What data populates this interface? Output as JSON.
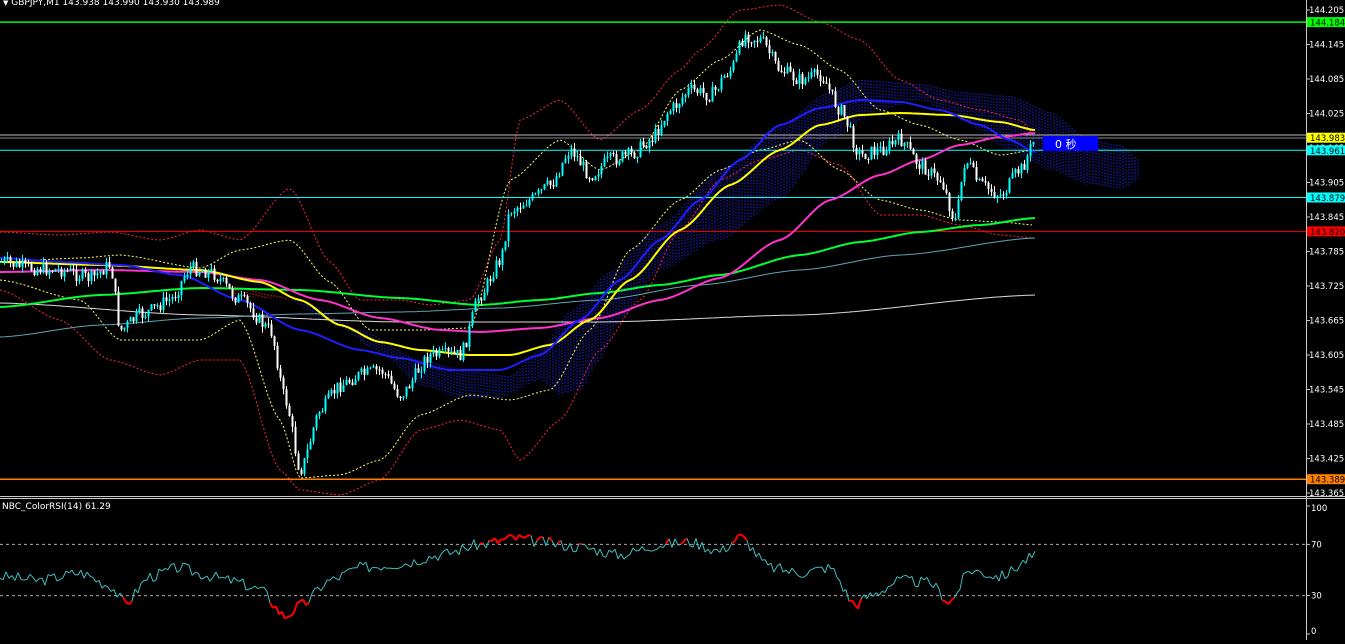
{
  "header": {
    "symbol_text": "GBPJPY,M1  143.938 143.990 143.930 143.989",
    "symbol_arrow": "▼"
  },
  "price_axis": {
    "ticks": [
      "144.205",
      "144.145",
      "144.085",
      "144.025",
      "143.965",
      "143.905",
      "143.845",
      "143.785",
      "143.725",
      "143.665",
      "143.605",
      "143.545",
      "143.485",
      "143.425",
      "143.365"
    ],
    "tags": [
      {
        "label": "144.184",
        "color": "#00ff00",
        "text_color": "#000000"
      },
      {
        "label": "143.983",
        "color": "#ffff00",
        "text_color": "#000000"
      },
      {
        "label": "143.961",
        "color": "#00ffff",
        "text_color": "#000000"
      },
      {
        "label": "143.879",
        "color": "#00ffff",
        "text_color": "#000000"
      },
      {
        "label": "143.820",
        "color": "#ff0000",
        "text_color": "#000000"
      },
      {
        "label": "143.389",
        "color": "#ff8000",
        "text_color": "#000000"
      }
    ]
  },
  "countdown": {
    "text": "0 秒",
    "color": "#0000ff"
  },
  "rsi_panel": {
    "title": "NBC_ColorRSI(14) 61.29",
    "ticks": [
      "100",
      "70",
      "30",
      "0"
    ]
  },
  "colors": {
    "background": "#000000",
    "bull_candle": "#00ffff",
    "bear_candle": "#ffffff",
    "ma_yellow": "#ffff00",
    "ma_blue": "#1e1eff",
    "ma_magenta": "#ff33cc",
    "ma_green": "#00ff33",
    "ma_teal": "#5fa5b4",
    "ma_white": "#dddddd",
    "bollinger_red": "#ff2244",
    "bollinger_yellow": "#ffff66",
    "rsi_line": "#40c0c0",
    "rsi_extreme": "#ff0000"
  }
}
